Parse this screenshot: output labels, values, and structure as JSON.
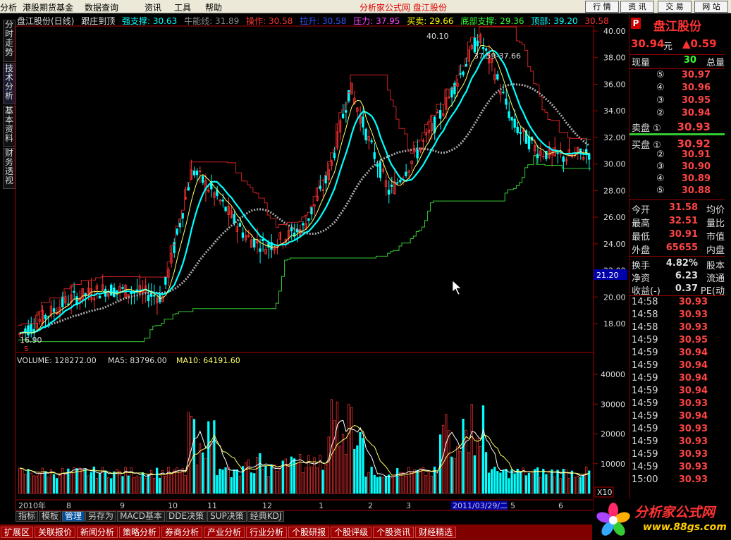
{
  "menu": {
    "items": [
      "分析",
      "港股期货基金",
      "数据查询",
      "资讯",
      "工具",
      "帮助"
    ],
    "center_title": "分析家公式网  盘江股份",
    "buttons": [
      "行 情",
      "资 讯",
      "交 易",
      "网 站"
    ]
  },
  "side_tabs": [
    "分时走势",
    "技术分析",
    "基本资料",
    "财务透视"
  ],
  "chart_header": {
    "name": "盘江股份(日线)",
    "formula": "跟庄到顶",
    "strong_support": "强支撑: 30.63",
    "bull_energy": "牛能线: 31.89",
    "operate": "操作: 30.58",
    "pull_up": "拉升: 30.58",
    "pressure": "压力: 37.95",
    "buy_sell": "买卖: 29.66",
    "bottom_support": "底部支撑: 29.36",
    "top": "顶部: 39.20",
    "last": "30.58"
  },
  "price_axis": [
    "40.00",
    "38.00",
    "36.00",
    "34.00",
    "32.00",
    "30.00",
    "28.00",
    "26.00",
    "24.00",
    "22.00",
    "20.00",
    "18.00"
  ],
  "price_tag": "21.20",
  "annotations": {
    "high": "40.10",
    "range": "37.59-37.66",
    "low": "16.90",
    "marker": "S"
  },
  "volume_header": {
    "volume": "VOLUME: 128272.00",
    "ma5": "MA5: 83796.00",
    "ma10": "MA10: 64191.60"
  },
  "volume_axis": [
    "40000",
    "30000",
    "20000",
    "10000"
  ],
  "volume_unit": "X10",
  "x_axis": [
    "2010年",
    "8",
    "9",
    "10",
    "11",
    "12",
    "1",
    "2",
    "3",
    "2011/03/29/二",
    "5",
    "6"
  ],
  "quote": {
    "badge": "P",
    "name": "盘江股份",
    "price": "30.94",
    "unit": "元",
    "change": "▲0.59",
    "xianliang_label": "现量",
    "xianliang": "30",
    "zongliang_label": "总量",
    "sell": [
      {
        "label": "⑤",
        "price": "30.97"
      },
      {
        "label": "④",
        "price": "30.96"
      },
      {
        "label": "③",
        "price": "30.95"
      },
      {
        "label": "②",
        "price": "30.94"
      },
      {
        "label": "卖盘 ①",
        "price": "30.93"
      }
    ],
    "buy": [
      {
        "label": "买盘 ①",
        "price": "30.92"
      },
      {
        "label": "②",
        "price": "30.91"
      },
      {
        "label": "③",
        "price": "30.90"
      },
      {
        "label": "④",
        "price": "30.89"
      },
      {
        "label": "⑤",
        "price": "30.88"
      }
    ],
    "stats": [
      {
        "l": "今开",
        "v": "31.58",
        "r": "均价"
      },
      {
        "l": "最高",
        "v": "32.51",
        "r": "量比"
      },
      {
        "l": "最低",
        "v": "30.91",
        "r": "市值"
      },
      {
        "l": "外盘",
        "v": "65655",
        "r": "内盘"
      }
    ],
    "stats2": [
      {
        "l": "换手",
        "v": "4.82%",
        "r": "股本"
      },
      {
        "l": "净资",
        "v": "6.23",
        "r": "流通"
      },
      {
        "l": "收益(-)",
        "v": "0.37",
        "r": "PE(动"
      }
    ],
    "ticks": [
      [
        "14:58",
        "30.93"
      ],
      [
        "14:58",
        "30.93"
      ],
      [
        "14:58",
        "30.93"
      ],
      [
        "14:59",
        "30.95"
      ],
      [
        "14:59",
        "30.94"
      ],
      [
        "14:59",
        "30.94"
      ],
      [
        "14:59",
        "30.94"
      ],
      [
        "14:59",
        "30.94"
      ],
      [
        "14:59",
        "30.93"
      ],
      [
        "14:59",
        "30.94"
      ],
      [
        "14:59",
        "30.93"
      ],
      [
        "14:59",
        "30.93"
      ],
      [
        "14:59",
        "30.93"
      ],
      [
        "14:59",
        "30.93"
      ],
      [
        "15:00",
        "30.93"
      ]
    ]
  },
  "bottom_tabs1": [
    "指标",
    "模板",
    "管理",
    "另存为",
    "MACD基本",
    "DDE决策",
    "SUP决策",
    "经典KDJ"
  ],
  "bottom_tabs2": [
    "扩展区",
    "关联报价",
    "新闻分析",
    "策略分析",
    "券商分析",
    "产业分析",
    "行业分析",
    "个股研报",
    "个股评级",
    "个股资讯",
    "财经精选"
  ],
  "logo": {
    "text": "分析家公式网",
    "url": "www.88gs.com"
  },
  "colors": {
    "bg": "#000000",
    "up": "#ff3333",
    "down": "#00ffff",
    "border": "#aa0000",
    "ma_white": "#ffffff",
    "ma_yellow": "#ffff00",
    "green_line": "#33cc33",
    "blue_line": "#3333ff"
  }
}
